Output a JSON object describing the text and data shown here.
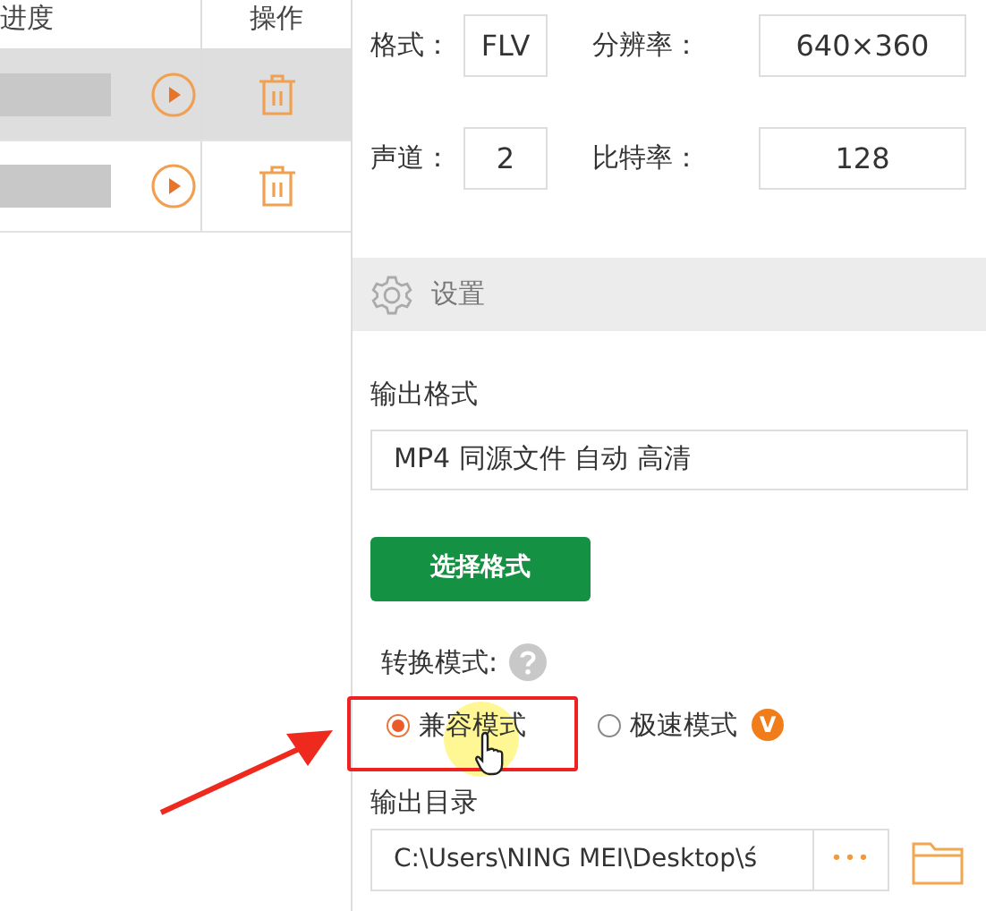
{
  "task_table": {
    "columns": [
      "进度",
      "操作"
    ],
    "rows": [
      {
        "selected": true
      },
      {
        "selected": false
      }
    ]
  },
  "source_info": [
    {
      "label": "格式：",
      "value": "FLV"
    },
    {
      "label": "分辨率：",
      "value": "640×360"
    },
    {
      "label": "声道：",
      "value": "2"
    },
    {
      "label": "比特率：",
      "value": "128"
    }
  ],
  "settings": {
    "title": "设置",
    "output_format_label": "输出格式",
    "output_format": "MP4 同源文件 自动 高清",
    "choose_button": "选择格式",
    "mode_label": "转换模式:",
    "modes": [
      {
        "label": "兼容模式",
        "selected": true
      },
      {
        "label": "极速模式",
        "selected": false,
        "badge": "V"
      }
    ],
    "output_dir_label": "输出目录",
    "output_dir": "C:\\Users\\NING MEI\\Desktop\\ś",
    "browse_button": "•••"
  }
}
